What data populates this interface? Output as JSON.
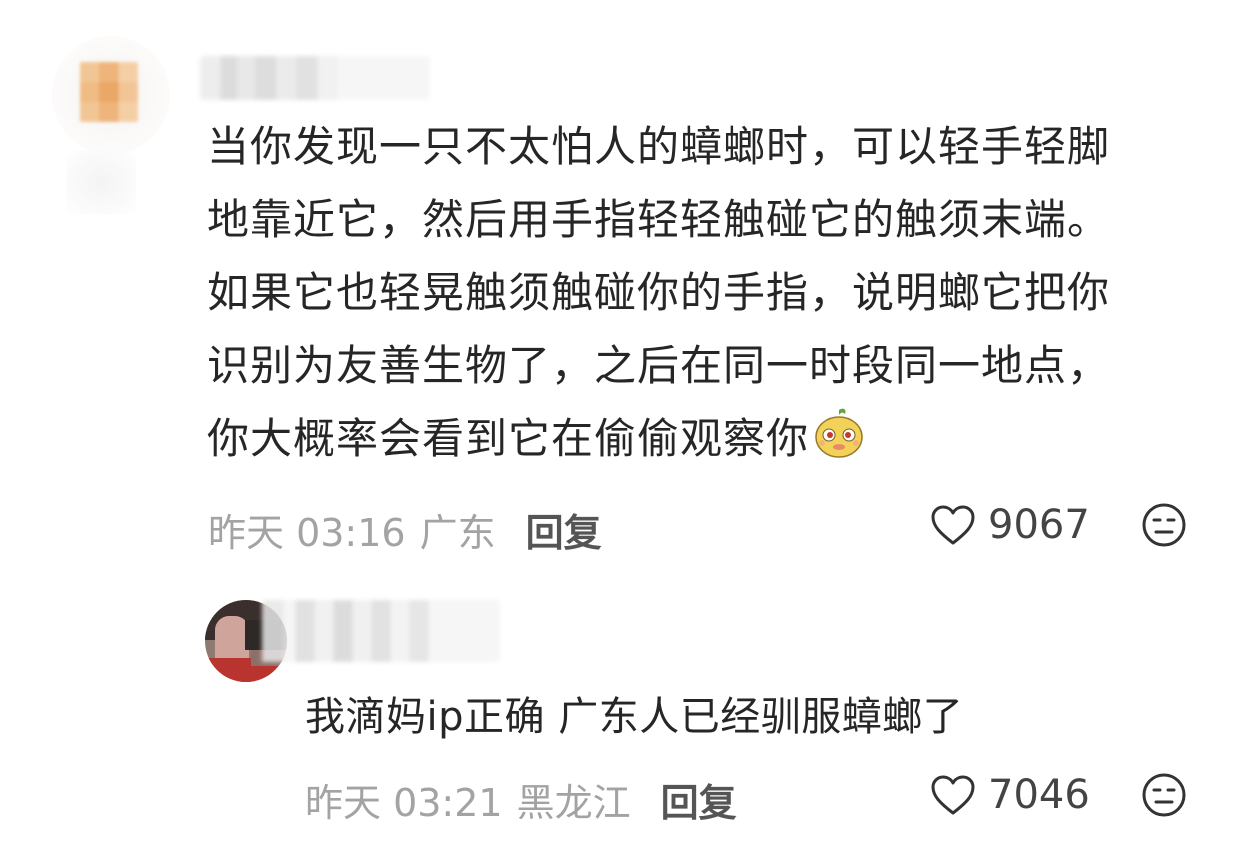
{
  "comment": {
    "lines": [
      "当你发现一只不太怕人的蟑螂时，可以轻手轻脚",
      "地靠近它，然后用手指轻轻触碰它的触须末端。",
      "如果它也轻晃触须触碰你的手指，说明螂它把你",
      "识别为友善生物了，之后在同一时段同一地点，",
      "你大概率会看到它在偷偷观察你"
    ],
    "emoji": "yellow-face-sticker",
    "time": "昨天 03:16",
    "location": "广东",
    "reply_label": "回复",
    "likes": "9067"
  },
  "reply": {
    "text": "我滴妈ip正确 广东人已经驯服蟑螂了",
    "time": "昨天 03:21",
    "location": "黑龙江",
    "reply_label": "回复",
    "likes": "7046"
  },
  "icons": {
    "like": "heart-outline-icon",
    "dislike": "frown-face-icon"
  },
  "colors": {
    "text": "#262626",
    "meta": "#a3a3a3",
    "reply_button": "#555555"
  }
}
